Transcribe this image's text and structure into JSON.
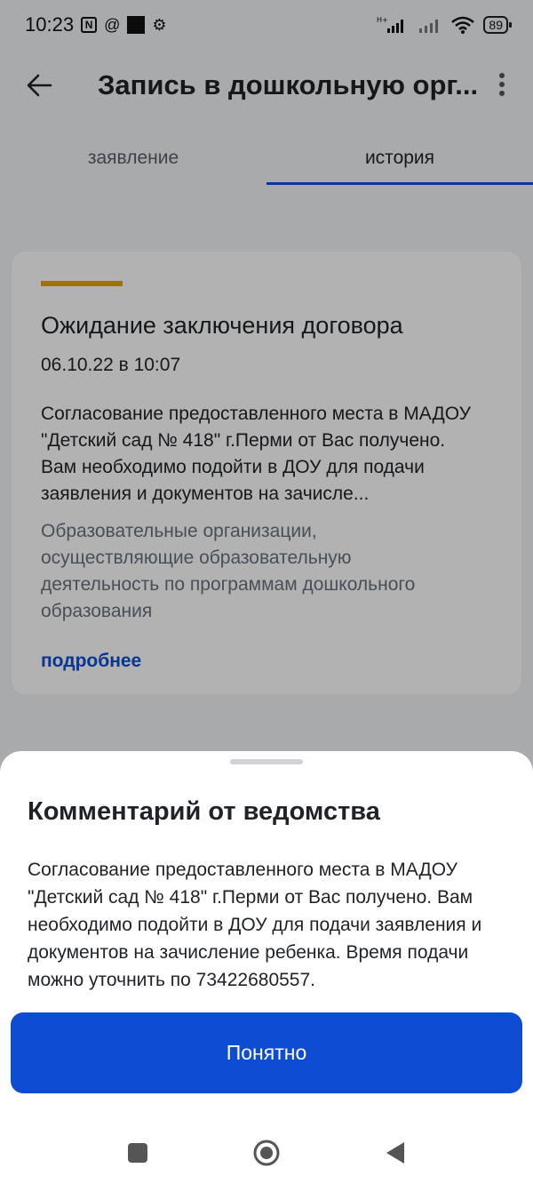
{
  "status_bar": {
    "time": "10:23",
    "battery": "89",
    "network_label": "H+"
  },
  "app_bar": {
    "title": "Запись в дошкольную орг..."
  },
  "tabs": [
    {
      "label": "заявление",
      "active": false
    },
    {
      "label": "история",
      "active": true
    }
  ],
  "card": {
    "status_title": "Ожидание заключения договора",
    "datetime": "06.10.22 в 10:07",
    "description": "Согласование предоставленного места в МАДОУ \"Детский сад № 418\" г.Перми от Вас получено. Вам необходимо подойти в ДОУ для подачи заявления и документов на зачисле...",
    "organization": "Образовательные организации, осуществляющие образовательную деятельность по программам дошкольного образования",
    "more_link": "подробнее"
  },
  "sheet": {
    "title": "Комментарий от ведомства",
    "body": "Согласование предоставленного места в МАДОУ \"Детский сад № 418\" г.Перми от Вас получено. Вам необходимо подойти в ДОУ для подачи заявления и документов на зачисление ребенка. Время подачи можно уточнить по 73422680557.",
    "button_label": "Понятно"
  },
  "colors": {
    "accent_blue": "#0d4cd3",
    "status_accent": "#e0a800"
  },
  "icons": [
    "back-arrow-icon",
    "more-vertical-icon",
    "wifi-icon",
    "signal-icon",
    "recent-apps-icon",
    "home-icon",
    "back-icon"
  ]
}
